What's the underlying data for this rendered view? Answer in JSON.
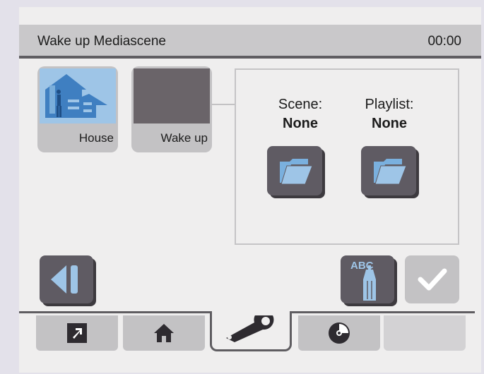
{
  "header": {
    "title": "Wake up Mediascene",
    "clock": "00:00"
  },
  "tiles": [
    {
      "label": "House",
      "icon": "house-person-icon"
    },
    {
      "label": "Wake up",
      "icon": "empty-thumbnail"
    }
  ],
  "info": {
    "scene": {
      "caption": "Scene:",
      "value": "None"
    },
    "playlist": {
      "caption": "Playlist:",
      "value": "None"
    }
  },
  "buttons": {
    "rename_text": "ABC"
  },
  "tabs": [
    {
      "icon": "shortcut-arrow-icon"
    },
    {
      "icon": "home-icon"
    },
    {
      "icon": "wrench-icon",
      "active": true
    },
    {
      "icon": "disc-icon"
    },
    {
      "icon": "empty"
    }
  ],
  "colors": {
    "accent_blue": "#9ec5e7",
    "button_dark": "#5f5b63",
    "panel_bg": "#efeeee",
    "title_bar": "#c9c8ca"
  }
}
